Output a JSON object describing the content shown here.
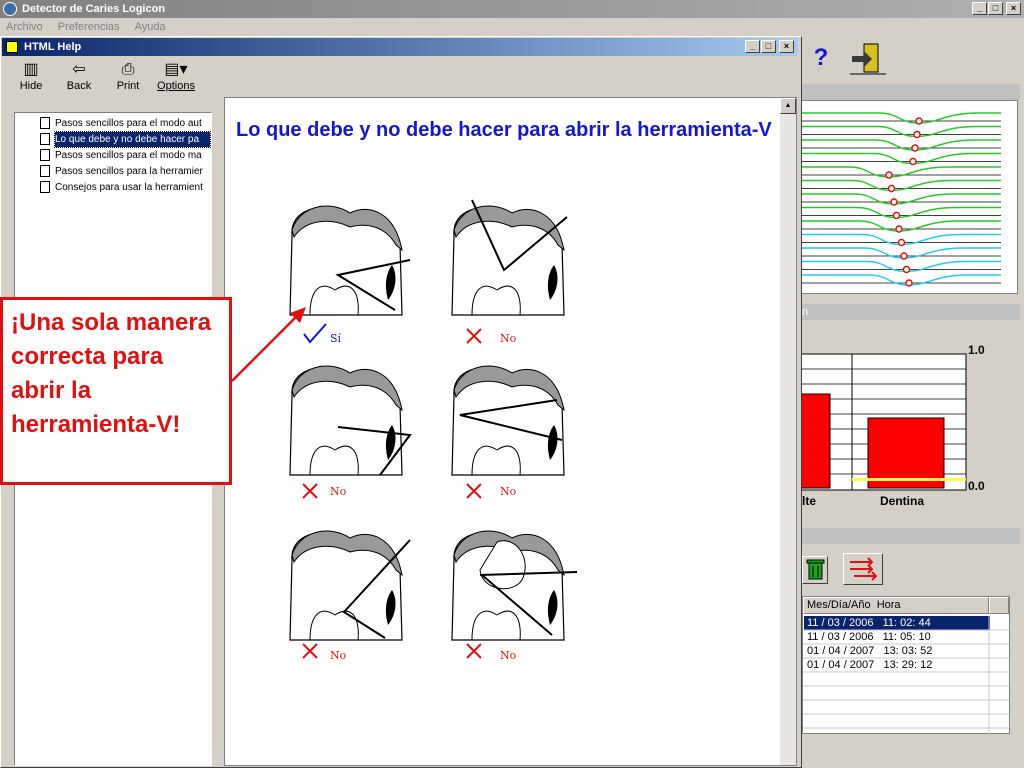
{
  "app": {
    "title": "Detector de Caries Logicon"
  },
  "menu": [
    "Archivo",
    "Preferencias",
    "Ayuda"
  ],
  "window_buttons": {
    "minimize": "_",
    "maximize": "□",
    "close": "×"
  },
  "help": {
    "title": "HTML Help",
    "toolbar": [
      {
        "label": "Hide",
        "icon": "hide-icon"
      },
      {
        "label": "Back",
        "icon": "back-arrow-icon"
      },
      {
        "label": "Print",
        "icon": "printer-icon"
      },
      {
        "label": "Options",
        "icon": "options-icon"
      }
    ],
    "topics": [
      "Pasos sencillos para el modo aut",
      "Lo que debe y no debe hacer pa",
      "Pasos sencillos para el modo ma",
      "Pasos sencillos para la herramier",
      "Consejos para usar la herramient"
    ],
    "selected_topic": 1,
    "content_title": "Lo que debe y no debe hacer para abrir la herramienta-V",
    "verdicts": [
      "Sí",
      "No",
      "No",
      "No",
      "No",
      "No"
    ]
  },
  "callout": {
    "text": "¡Una sola manera correcta para abrir la herramienta-V!"
  },
  "right_panel": {
    "section2_header": "n",
    "chart_labels": {
      "top": "1.0",
      "bottom": "0.0",
      "left_bar": "lte",
      "right_bar": "Dentina"
    },
    "table_headers": {
      "date_time": "Mes/Día/Año  Hora"
    },
    "records": [
      "11 / 03 / 2006   11: 02: 44",
      "11 / 03 / 2006   11: 05: 10",
      "01 / 04 / 2007   13: 03: 52",
      "01 / 04 / 2007   13: 29: 12"
    ]
  },
  "colors": {
    "accent": "#1515d8",
    "callout": "#e01010",
    "bar": "#ff0000",
    "selection": "#0a246a"
  }
}
